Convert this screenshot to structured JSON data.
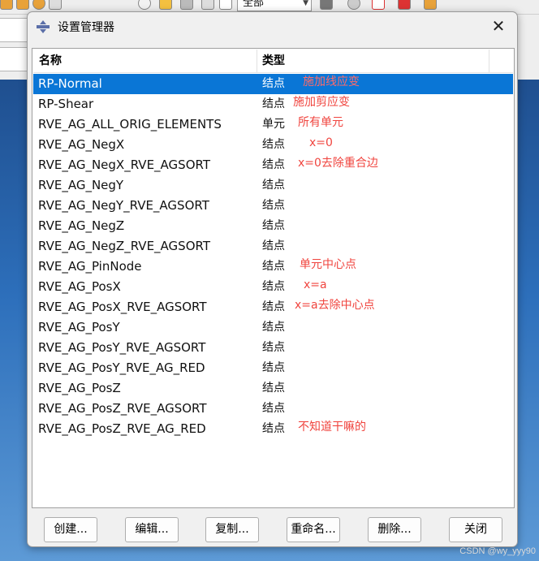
{
  "background": {
    "combo_value": "全部"
  },
  "dialog": {
    "title": "设置管理器",
    "close_glyph": "✕",
    "columns": {
      "name": "名称",
      "type": "类型"
    },
    "rows": [
      {
        "name": "RP-Normal",
        "type": "结点",
        "note": "施加线应变",
        "selected": true
      },
      {
        "name": "RP-Shear",
        "type": "结点",
        "note": "施加剪应变"
      },
      {
        "name": "RVE_AG_ALL_ORIG_ELEMENTS",
        "type": "单元",
        "note": "所有单元"
      },
      {
        "name": "RVE_AG_NegX",
        "type": "结点",
        "note": "x=0"
      },
      {
        "name": "RVE_AG_NegX_RVE_AGSORT",
        "type": "结点",
        "note": "x=0去除重合边"
      },
      {
        "name": "RVE_AG_NegY",
        "type": "结点",
        "note": ""
      },
      {
        "name": "RVE_AG_NegY_RVE_AGSORT",
        "type": "结点",
        "note": ""
      },
      {
        "name": "RVE_AG_NegZ",
        "type": "结点",
        "note": ""
      },
      {
        "name": "RVE_AG_NegZ_RVE_AGSORT",
        "type": "结点",
        "note": ""
      },
      {
        "name": "RVE_AG_PinNode",
        "type": "结点",
        "note": "单元中心点"
      },
      {
        "name": "RVE_AG_PosX",
        "type": "结点",
        "note": "x=a"
      },
      {
        "name": "RVE_AG_PosX_RVE_AGSORT",
        "type": "结点",
        "note": "x=a去除中心点"
      },
      {
        "name": "RVE_AG_PosY",
        "type": "结点",
        "note": ""
      },
      {
        "name": "RVE_AG_PosY_RVE_AGSORT",
        "type": "结点",
        "note": ""
      },
      {
        "name": "RVE_AG_PosY_RVE_AG_RED",
        "type": "结点",
        "note": ""
      },
      {
        "name": "RVE_AG_PosZ",
        "type": "结点",
        "note": ""
      },
      {
        "name": "RVE_AG_PosZ_RVE_AGSORT",
        "type": "结点",
        "note": ""
      },
      {
        "name": "RVE_AG_PosZ_RVE_AG_RED",
        "type": "结点",
        "note": "不知道干嘛的"
      }
    ],
    "buttons": {
      "create": "创建...",
      "edit": "编辑...",
      "copy": "复制...",
      "rename": "重命名...",
      "delete": "删除...",
      "close": "关闭"
    }
  },
  "watermark": "CSDN @wy_yyy90",
  "colors": {
    "selection": "#0a76d6",
    "annotation": "#f0453f"
  }
}
